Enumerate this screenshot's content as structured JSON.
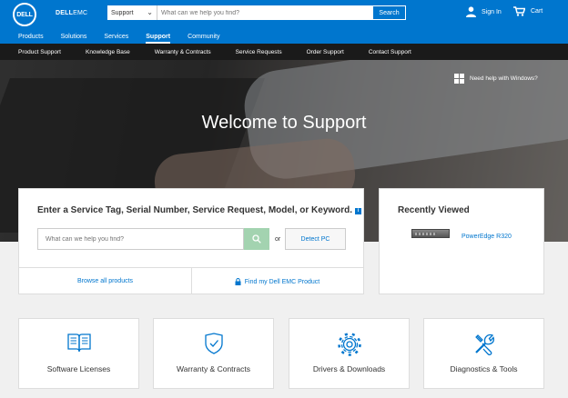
{
  "header": {
    "logo_text": "DELL",
    "brand_bold": "DELL",
    "brand_light": "EMC",
    "search_scope": "Support",
    "search_placeholder": "What can we help you find?",
    "search_button": "Search",
    "signin_label": "Sign In",
    "cart_label": "Cart"
  },
  "nav": {
    "items": [
      "Products",
      "Solutions",
      "Services",
      "Support",
      "Community"
    ],
    "active": "Support"
  },
  "subnav": {
    "items": [
      "Product Support",
      "Knowledge Base",
      "Warranty & Contracts",
      "Service Requests",
      "Order Support",
      "Contact Support"
    ]
  },
  "hero": {
    "title": "Welcome to Support",
    "windows_help": "Need help with Windows?"
  },
  "search_card": {
    "heading": "Enter a Service Tag, Serial Number, Service Request, Model, or Keyword.",
    "info_badge": "i",
    "placeholder": "What can we help you find?",
    "or_text": "or",
    "detect_button": "Detect PC",
    "browse_link": "Browse all products",
    "find_link": "Find my Dell EMC Product"
  },
  "recent": {
    "heading": "Recently Viewed",
    "items": [
      {
        "label": "PowerEdge R320"
      }
    ]
  },
  "tiles": [
    {
      "label": "Software Licenses",
      "icon": "book-icon"
    },
    {
      "label": "Warranty & Contracts",
      "icon": "shield-check-icon"
    },
    {
      "label": "Drivers & Downloads",
      "icon": "gear-icon"
    },
    {
      "label": "Diagnostics & Tools",
      "icon": "tools-icon"
    }
  ],
  "colors": {
    "brand_blue": "#0076ce",
    "subnav_bg": "#1a1a1a",
    "go_button": "#a3d3b0"
  }
}
